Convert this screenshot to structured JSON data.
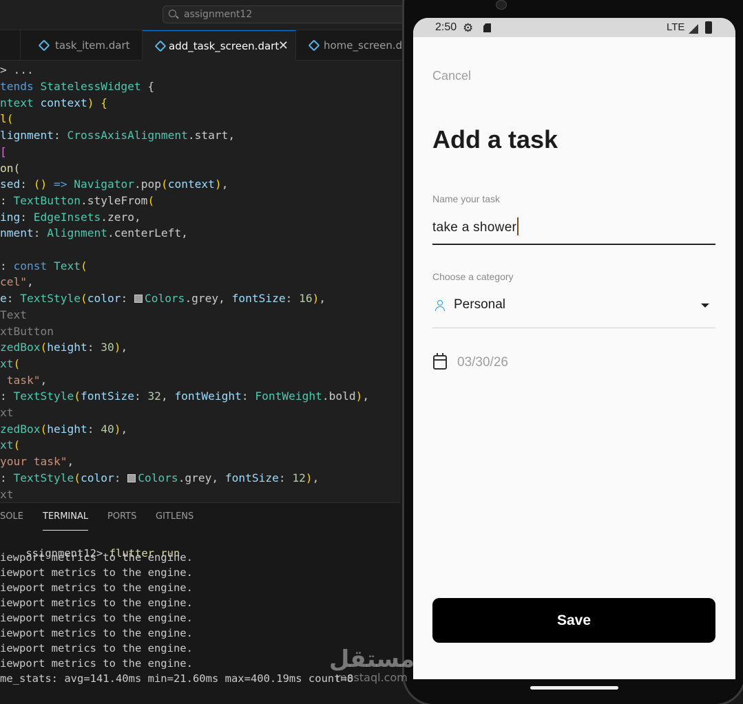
{
  "editor": {
    "search": "assignment12",
    "tabs": [
      {
        "label": "task_item.dart",
        "active": false
      },
      {
        "label": "add_task_screen.dart",
        "active": true
      },
      {
        "label": "home_screen.da",
        "active": false
      }
    ],
    "breadcrumb": "> ...",
    "code_lines": [
      [
        [
          "k",
          "tends "
        ],
        [
          "t",
          "StatelessWidget "
        ],
        [
          "",
          "{"
        ]
      ],
      [
        [
          "t",
          "ntext "
        ],
        [
          "p",
          "context"
        ],
        [
          "y",
          ") {"
        ]
      ],
      [
        [
          "y",
          "l("
        ]
      ],
      [
        [
          "p",
          "lignment"
        ],
        [
          "",
          ": "
        ],
        [
          "t",
          "CrossAxisAlignment"
        ],
        [
          "",
          ".start,"
        ]
      ],
      [
        [
          "m",
          "["
        ]
      ],
      [
        [
          "f",
          "on("
        ]
      ],
      [
        [
          "p",
          "sed"
        ],
        [
          "",
          ": "
        ],
        [
          "y",
          "() "
        ],
        [
          "k",
          "=> "
        ],
        [
          "t",
          "Navigator"
        ],
        [
          "",
          ".pop"
        ],
        [
          "y",
          "("
        ],
        [
          "p",
          "context"
        ],
        [
          "y",
          ")"
        ],
        [
          "",
          ","
        ]
      ],
      [
        [
          "",
          ": "
        ],
        [
          "t",
          "TextButton"
        ],
        [
          "",
          ".styleFrom"
        ],
        [
          "y",
          "("
        ]
      ],
      [
        [
          "p",
          "ing"
        ],
        [
          "",
          ": "
        ],
        [
          "t",
          "EdgeInsets"
        ],
        [
          "",
          ".zero,"
        ]
      ],
      [
        [
          "p",
          "nment"
        ],
        [
          "",
          ": "
        ],
        [
          "t",
          "Alignment"
        ],
        [
          "",
          ".centerLeft,"
        ]
      ],
      [
        [
          "",
          ""
        ]
      ],
      [
        [
          "",
          ": "
        ],
        [
          "k",
          "const "
        ],
        [
          "t",
          "Text"
        ],
        [
          "y",
          "("
        ]
      ],
      [
        [
          "s",
          "cel\""
        ],
        [
          "",
          ","
        ]
      ],
      [
        [
          "p",
          "e"
        ],
        [
          "",
          ": "
        ],
        [
          "t",
          "TextStyle"
        ],
        [
          "y",
          "("
        ],
        [
          "p",
          "color"
        ],
        [
          "",
          ": "
        ],
        [
          "sw",
          ""
        ],
        [
          "t",
          "Colors"
        ],
        [
          "",
          ".grey, "
        ],
        [
          "p",
          "fontSize"
        ],
        [
          "",
          ": "
        ],
        [
          "n",
          "16"
        ],
        [
          "y",
          ")"
        ],
        [
          "",
          ","
        ]
      ],
      [
        [
          "c",
          "Text"
        ]
      ],
      [
        [
          "c",
          "xtButton"
        ]
      ],
      [
        [
          "t",
          "zedBox"
        ],
        [
          "y",
          "("
        ],
        [
          "p",
          "height"
        ],
        [
          "",
          ": "
        ],
        [
          "n",
          "30"
        ],
        [
          "y",
          ")"
        ],
        [
          "",
          ","
        ]
      ],
      [
        [
          "t",
          "xt"
        ],
        [
          "y",
          "("
        ]
      ],
      [
        [
          "s",
          " task\""
        ],
        [
          "",
          ","
        ]
      ],
      [
        [
          "",
          ": "
        ],
        [
          "t",
          "TextStyle"
        ],
        [
          "y",
          "("
        ],
        [
          "p",
          "fontSize"
        ],
        [
          "",
          ": "
        ],
        [
          "n",
          "32"
        ],
        [
          "",
          ", "
        ],
        [
          "p",
          "fontWeight"
        ],
        [
          "",
          ": "
        ],
        [
          "t",
          "FontWeight"
        ],
        [
          "",
          ".bold"
        ],
        [
          "y",
          ")"
        ],
        [
          "",
          ","
        ]
      ],
      [
        [
          "c",
          "xt"
        ]
      ],
      [
        [
          "t",
          "zedBox"
        ],
        [
          "y",
          "("
        ],
        [
          "p",
          "height"
        ],
        [
          "",
          ": "
        ],
        [
          "n",
          "40"
        ],
        [
          "y",
          ")"
        ],
        [
          "",
          ","
        ]
      ],
      [
        [
          "t",
          "xt"
        ],
        [
          "y",
          "("
        ]
      ],
      [
        [
          "s",
          "your task\""
        ],
        [
          "",
          ","
        ]
      ],
      [
        [
          "",
          ": "
        ],
        [
          "t",
          "TextStyle"
        ],
        [
          "y",
          "("
        ],
        [
          "p",
          "color"
        ],
        [
          "",
          ": "
        ],
        [
          "sw",
          ""
        ],
        [
          "t",
          "Colors"
        ],
        [
          "",
          ".grey, "
        ],
        [
          "p",
          "fontSize"
        ],
        [
          "",
          ": "
        ],
        [
          "n",
          "12"
        ],
        [
          "y",
          ")"
        ],
        [
          "",
          ","
        ]
      ],
      [
        [
          "c",
          "xt"
        ]
      ]
    ],
    "panel_tabs": [
      "SOLE",
      "TERMINAL",
      "PORTS",
      "GITLENS"
    ],
    "active_panel_tab": "TERMINAL",
    "terminal_prompt": "ssignment12> ",
    "terminal_cmd": "flutter run",
    "terminal_lines": [
      "iewport metrics to the engine.",
      "iewport metrics to the engine.",
      "iewport metrics to the engine.",
      "iewport metrics to the engine.",
      "iewport metrics to the engine.",
      "iewport metrics to the engine.",
      "iewport metrics to the engine.",
      "iewport metrics to the engine.",
      "me_stats: avg=141.40ms min=21.60ms max=400.19ms count=8"
    ]
  },
  "phone": {
    "status": {
      "time": "2:50",
      "network": "LTE",
      "gear_icon": "gear-icon"
    },
    "cancel_label": "Cancel",
    "title": "Add a task",
    "name_label": "Name your task",
    "name_value": "take a shower",
    "category_label": "Choose a category",
    "category_value": "Personal",
    "date_value": "03/30/26",
    "save_label": "Save"
  },
  "watermark": {
    "arabic": "مستقل",
    "latin": "mostaql.com"
  }
}
